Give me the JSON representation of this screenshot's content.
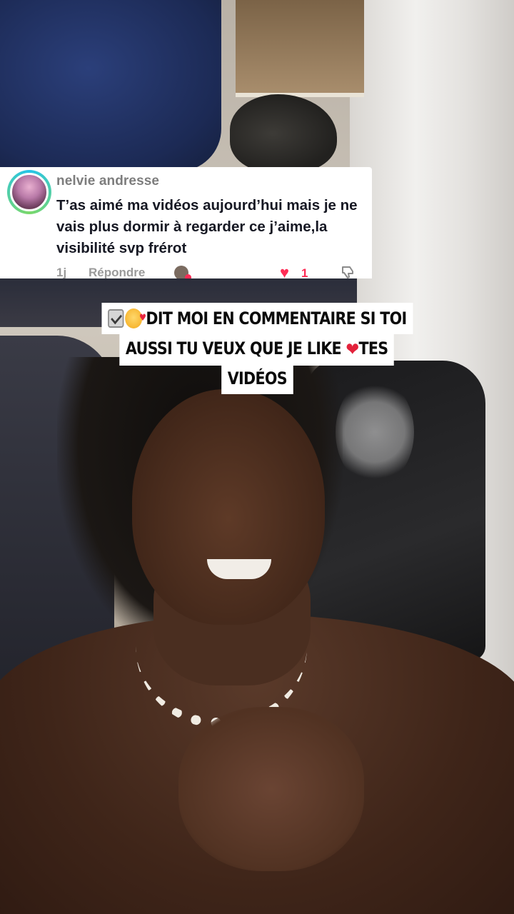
{
  "comment": {
    "username": "nelvie andresse",
    "text": "T’as aimé ma vidéos aujourd’hui mais je ne vais plus dormir à regarder ce j’aime,la visibilité svp frérot",
    "time": "1j",
    "reply_label": "Répondre",
    "like_count": "1",
    "like_color": "#fe2c55"
  },
  "caption": {
    "line1": "Dit moi en commentaire si toi",
    "line2_a": "aussi tu veux que je like",
    "line2_b": "tes",
    "line3": "vidéos",
    "icons": [
      "check-box-icon",
      "smiling-face-hearts-icon",
      "red-heart-icon"
    ]
  }
}
